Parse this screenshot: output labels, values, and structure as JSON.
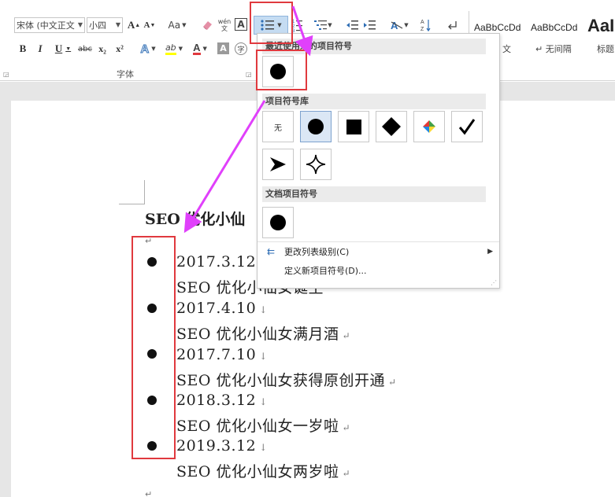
{
  "ribbon": {
    "font_name": "宋体 (中文正文",
    "font_size": "小四",
    "grow_font": "A",
    "shrink_font": "A",
    "change_case": "Aa",
    "phonetic": "wén\n文",
    "char_border": "A",
    "bold": "B",
    "italic": "I",
    "underline": "U",
    "strikethrough": "abc",
    "subscript": "x₂",
    "superscript": "x²",
    "text_effects": "A",
    "highlight": "ab",
    "font_color": "A",
    "char_shading": "A",
    "enclose_char": "字",
    "font_group_label": "字体",
    "styles": [
      {
        "sample": "AaBbCcDd",
        "name": "文"
      },
      {
        "sample": "AaBbCcDd",
        "name": "↵ 无间隔"
      },
      {
        "sample": "AaI",
        "name": "标题"
      }
    ]
  },
  "bullet_menu": {
    "recent_header": "最近使用过的项目符号",
    "library_header": "项目符号库",
    "library_none": "无",
    "document_header": "文档项目符号",
    "change_level": "更改列表级别(C)",
    "define_new": "定义新项目符号(D)...",
    "library_icons": [
      "none",
      "filled-circle",
      "filled-square",
      "filled-diamond",
      "four-color-diamond",
      "checkmark",
      "arrowhead",
      "four-point-star"
    ]
  },
  "document": {
    "title": "SEO 优化小仙",
    "items": [
      {
        "date": "2017.3.12",
        "text": "SEO 优化小仙女诞生"
      },
      {
        "date": "2017.4.10",
        "text": "SEO 优化小仙女满月酒"
      },
      {
        "date": "2017.7.10",
        "text": "SEO 优化小仙女获得原创开通"
      },
      {
        "date": "2018.3.12",
        "text": "SEO 优化小仙女一岁啦"
      },
      {
        "date": "2019.3.12",
        "text": "SEO 优化小仙女两岁啦"
      }
    ],
    "para_mark": "↵",
    "line_break": "↓"
  },
  "colors": {
    "annotation_red": "#e0393e",
    "arrow_magenta": "#e040fb",
    "highlight_yellow": "#ffff00",
    "font_red": "#e0393e"
  }
}
